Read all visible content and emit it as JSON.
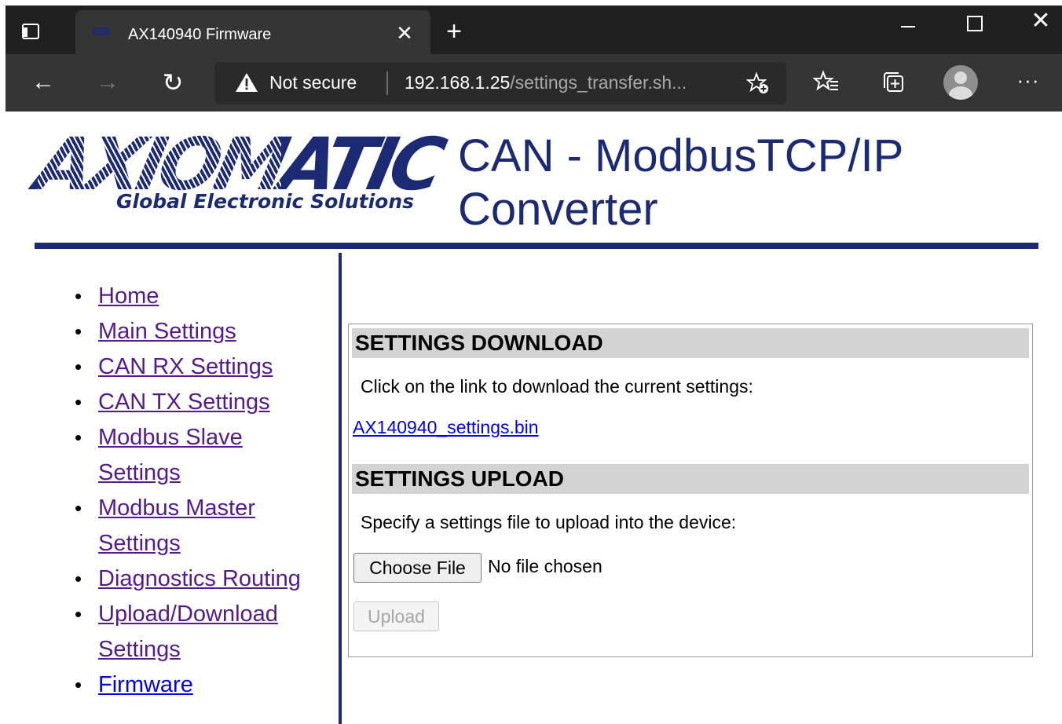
{
  "browser": {
    "tab_title": "AX140940 Firmware",
    "security_label": "Not secure",
    "url_host": "192.168.1.25",
    "url_path": "/settings_transfer.sh..."
  },
  "header": {
    "logo_text": "AXIOMATIC",
    "logo_tagline": "Global Electronic Solutions",
    "page_title": "CAN - ModbusTCP/IP Converter"
  },
  "sidebar": {
    "items": [
      {
        "label": "Home"
      },
      {
        "label": "Main Settings"
      },
      {
        "label": "CAN RX Settings"
      },
      {
        "label": "CAN TX Settings"
      },
      {
        "label": "Modbus Slave Settings"
      },
      {
        "label": "Modbus Master Settings"
      },
      {
        "label": "Diagnostics Routing"
      },
      {
        "label": "Upload/Download Settings"
      },
      {
        "label": "Firmware"
      }
    ]
  },
  "download": {
    "heading": "SETTINGS DOWNLOAD",
    "instruction": "Click on the link to download the current settings:",
    "file_link": "AX140940_settings.bin"
  },
  "upload": {
    "heading": "SETTINGS UPLOAD",
    "instruction": "Specify a settings file to upload into the device:",
    "choose_button": "Choose File",
    "file_status": "No file chosen",
    "upload_button": "Upload"
  },
  "colors": {
    "brand_navy": "#1b2a73",
    "section_heading_bg": "#d3d3d3",
    "visited_link": "#551a8b",
    "link": "#0000ee"
  }
}
